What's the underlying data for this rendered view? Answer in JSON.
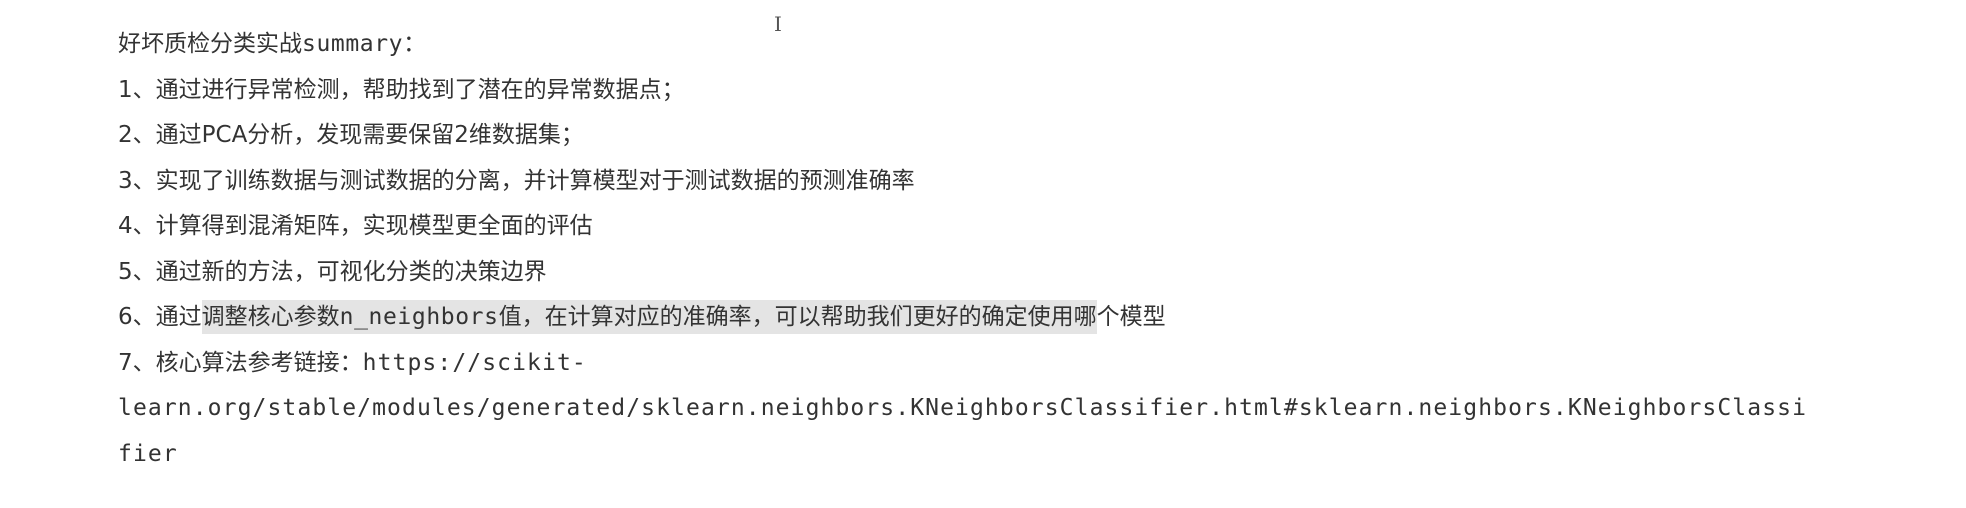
{
  "cursor_glyph": "I",
  "document": {
    "heading": {
      "prefix": "好坏质检分类实战",
      "code": "summary",
      "suffix": "："
    },
    "items": [
      {
        "text": "1、通过进行异常检测，帮助找到了潜在的异常数据点；"
      },
      {
        "text": "2、通过PCA分析，发现需要保留2维数据集；"
      },
      {
        "text": "3、实现了训练数据与测试数据的分离，并计算模型对于测试数据的预测准确率"
      },
      {
        "text": "4、计算得到混淆矩阵，实现模型更全面的评估"
      },
      {
        "text": "5、通过新的方法，可视化分类的决策边界"
      }
    ],
    "item6": {
      "before": "6、通过",
      "highlight_prefix": "调整核心参数",
      "highlight_code": "n_neighbors",
      "highlight_suffix": "值，在计算对应的准确率，可以帮助我们更好的确定使用哪",
      "after": "个模型"
    },
    "item7": {
      "label": "7、核心算法参考链接：",
      "url_line1": "https://scikit-",
      "url_line2": "learn.org/stable/modules/generated/sklearn.neighbors.KNeighborsClassifier.html#sklearn.neighbors.KNeighborsClassi",
      "url_line3": "fier"
    }
  }
}
